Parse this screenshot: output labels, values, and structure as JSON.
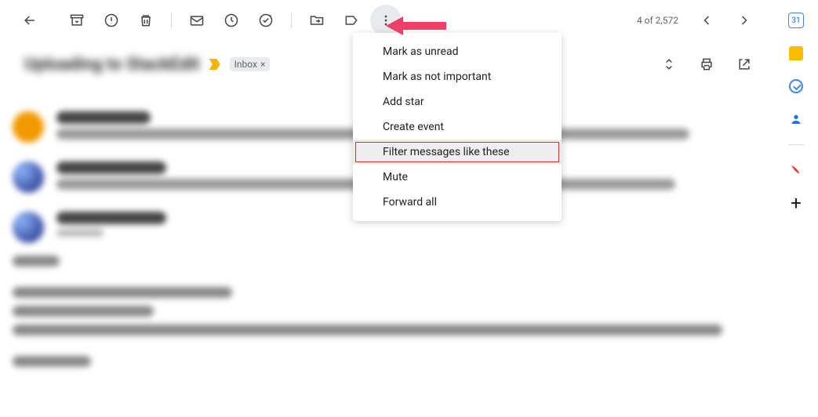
{
  "toolbar": {
    "pagination": "4 of 2,572"
  },
  "subject": {
    "blurred_text": "Uploading to StackEdit",
    "inbox_label": "Inbox"
  },
  "menu": {
    "items": [
      {
        "label": "Mark as unread",
        "highlighted": false
      },
      {
        "label": "Mark as not important",
        "highlighted": false
      },
      {
        "label": "Add star",
        "highlighted": false
      },
      {
        "label": "Create event",
        "highlighted": false
      },
      {
        "label": "Filter messages like these",
        "highlighted": true
      },
      {
        "label": "Mute",
        "highlighted": false
      },
      {
        "label": "Forward all",
        "highlighted": false
      }
    ]
  },
  "side": {
    "calendar_day": "31"
  }
}
